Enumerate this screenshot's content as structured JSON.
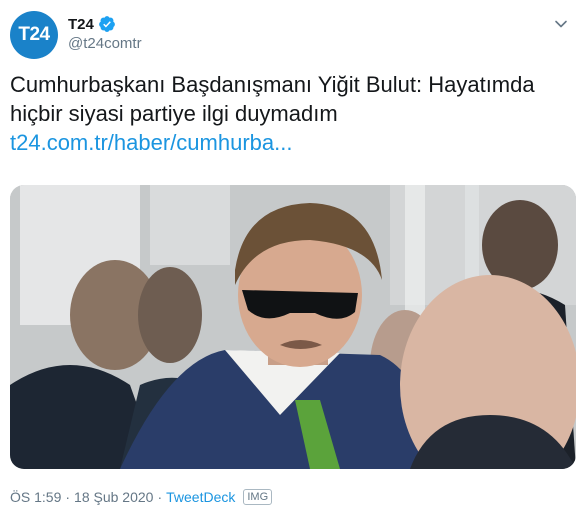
{
  "account": {
    "avatar_text": "T24",
    "display_name": "T24",
    "handle": "@t24comtr",
    "brand_color": "#1a82c9"
  },
  "tweet": {
    "text": "Cumhurbaşkanı Başdanışmanı Yiğit Bulut: Hayatımda hiçbir siyasi partiye ilgi duymadım",
    "link": "t24.com.tr/haber/cumhurba...",
    "link_color": "#1b95e0"
  },
  "footer": {
    "time": "ÖS 1:59",
    "separator": "·",
    "date": "18 Şub 2020",
    "source": "TweetDeck",
    "badge": "IMG"
  },
  "icons": [
    "verified-badge-icon",
    "chevron-down-icon"
  ]
}
